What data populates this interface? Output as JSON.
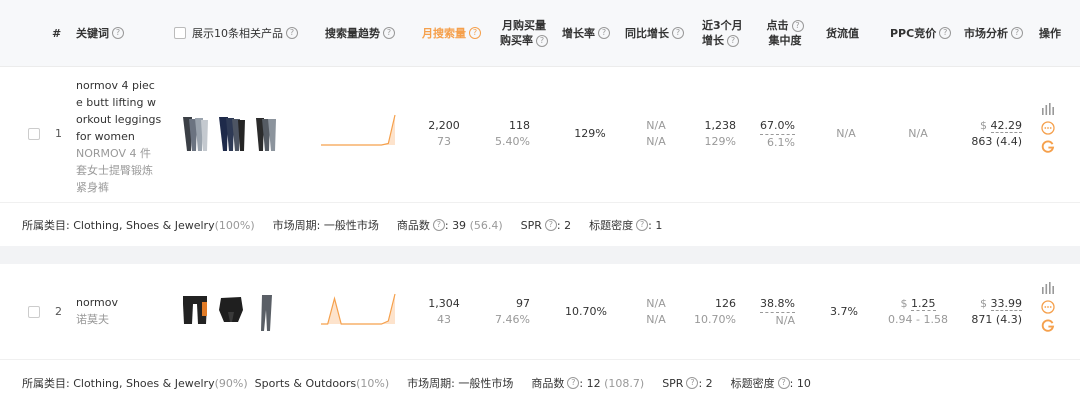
{
  "header": {
    "index": "#",
    "keyword": "关键词",
    "products": "展示10条相关产品",
    "trend": "搜索量趋势",
    "monthly_search": "月搜索量",
    "monthly_buy_line1": "月购买量",
    "monthly_buy_line2": "购买率",
    "growth": "增长率",
    "yoy": "同比增长",
    "three_month_line1": "近3个月",
    "three_month_line2": "增长",
    "click_line1": "点击",
    "click_line2": "集中度",
    "flow": "货流值",
    "ppc": "PPC竞价",
    "market": "市场分析",
    "ops": "操作"
  },
  "rows": [
    {
      "index": "1",
      "keyword_lines": [
        "normov 4 piec",
        "e butt lifting w",
        "orkout leggings",
        "for women"
      ],
      "translation_lines": [
        "NORMOV 4 件",
        "套女士提臀锻炼",
        "紧身裤"
      ],
      "monthly_search": "2,200",
      "monthly_search_sub": "73",
      "monthly_buy": "118",
      "buy_rate": "5.40%",
      "growth": "129%",
      "yoy": "N/A",
      "yoy_sub": "N/A",
      "three_month": "1,238",
      "three_month_sub": "129%",
      "click": "67.0%",
      "click_sub": "6.1%",
      "flow": "N/A",
      "ppc": "N/A",
      "ppc_sub": "",
      "market_price": "42.29",
      "market_sub": "863 (4.4)",
      "trend": [
        0,
        0,
        0,
        0,
        0,
        0,
        0,
        0,
        0,
        0,
        0.05,
        1
      ]
    },
    {
      "index": "2",
      "keyword_lines": [
        "normov"
      ],
      "translation_lines": [
        "诺莫夫"
      ],
      "monthly_search": "1,304",
      "monthly_search_sub": "43",
      "monthly_buy": "97",
      "buy_rate": "7.46%",
      "growth": "10.70%",
      "yoy": "N/A",
      "yoy_sub": "N/A",
      "three_month": "126",
      "three_month_sub": "10.70%",
      "click": "38.8%",
      "click_sub": "N/A",
      "flow": "3.7%",
      "ppc": "1.25",
      "ppc_sub": "0.94 - 1.58",
      "market_price": "33.99",
      "market_sub": "871 (4.3)",
      "trend": [
        0,
        0,
        0.85,
        0,
        0,
        0,
        0,
        0,
        0,
        0,
        0.1,
        1
      ]
    }
  ],
  "categories": [
    {
      "label": "所属类目:",
      "items": [
        {
          "name": "Clothing, Shoes & Jewelry",
          "pct": "(100%)"
        }
      ],
      "cycle_label": "市场周期:",
      "cycle_value": "一般性市场",
      "products_label": "商品数",
      "products_value": "39",
      "products_sub": "(56.4)",
      "spr_label": "SPR",
      "spr_value": "2",
      "title_label": "标题密度",
      "title_value": "1"
    },
    {
      "label": "所属类目:",
      "items": [
        {
          "name": "Clothing, Shoes & Jewelry",
          "pct": "(90%)"
        },
        {
          "name": "Sports & Outdoors",
          "pct": "(10%)"
        }
      ],
      "cycle_label": "市场周期:",
      "cycle_value": "一般性市场",
      "products_label": "商品数",
      "products_value": "12",
      "products_sub": "(108.7)",
      "spr_label": "SPR",
      "spr_value": "2",
      "title_label": "标题密度",
      "title_value": "10"
    }
  ],
  "symbols": {
    "currency": "$",
    "help": "?",
    "colon": ":"
  },
  "icons": [
    "bar-chart-icon",
    "more-circle-icon",
    "google-icon",
    "help-circle-icon"
  ],
  "colors": {
    "accent": "#f5a04c",
    "muted": "#999999",
    "header_bg": "#f7f8fa",
    "separator": "#f2f3f5"
  }
}
